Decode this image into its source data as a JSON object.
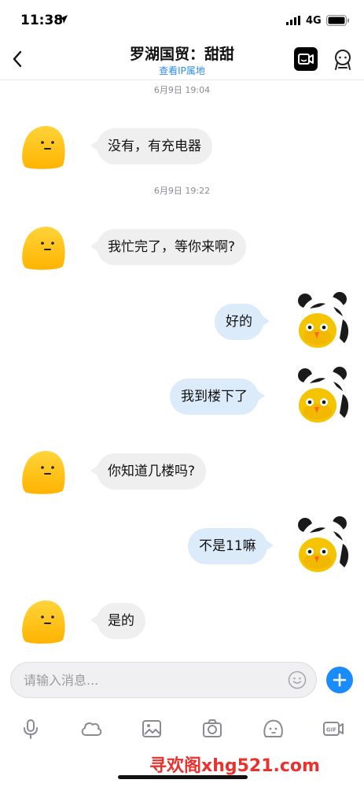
{
  "status_bar": {
    "time": "11:38",
    "network": "4G"
  },
  "header": {
    "title": "罗湖国贸：甜甜",
    "subtitle": "查看IP属地"
  },
  "messages": [
    {
      "type": "timestamp",
      "text": "6月9日 19:04"
    },
    {
      "type": "incoming",
      "text": "没有，有充电器"
    },
    {
      "type": "timestamp",
      "text": "6月9日 19:22"
    },
    {
      "type": "incoming",
      "text": "我忙完了，等你来啊?"
    },
    {
      "type": "outgoing",
      "text": "好的"
    },
    {
      "type": "outgoing",
      "text": "我到楼下了"
    },
    {
      "type": "incoming",
      "text": "你知道几楼吗?"
    },
    {
      "type": "outgoing",
      "text": "不是11嘛"
    },
    {
      "type": "incoming",
      "text": "是的"
    }
  ],
  "input": {
    "placeholder": "请输入消息..."
  },
  "toolbar": {
    "icons": [
      "microphone-icon",
      "cloud-icon",
      "image-icon",
      "camera-icon",
      "sticker-icon",
      "gif-icon"
    ]
  },
  "watermark": "寻欢阁xhg521.com",
  "colors": {
    "accent": "#1a8cff",
    "outgoing_bubble": "#dcebfa",
    "incoming_bubble": "#efefef",
    "link": "#2d8cf0"
  }
}
